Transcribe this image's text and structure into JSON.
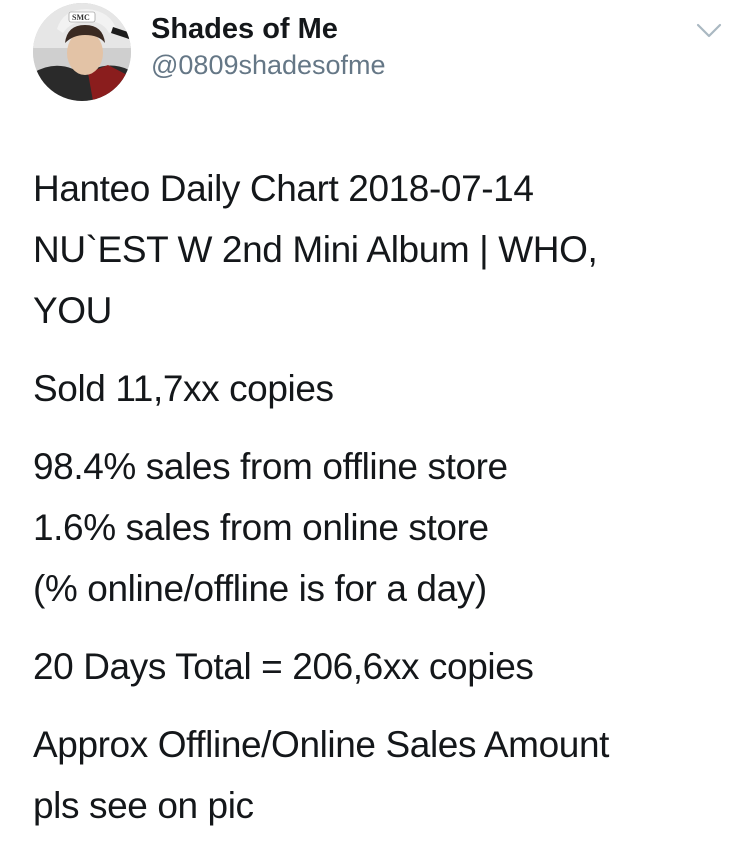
{
  "tweet": {
    "author": {
      "display_name": "Shades of Me",
      "handle": "@0809shadesofme",
      "avatar_icon": "profile-photo",
      "avatar_cap_text": "SMC"
    },
    "menu_icon": "chevron-down-icon",
    "body_lines": [
      "Hanteo Daily Chart 2018-07-14",
      "NU`EST W 2nd Mini Album | WHO,",
      "YOU",
      "Sold 11,7xx copies",
      "98.4% sales from offline store",
      "1.6% sales from online store",
      "(% online/offline is for a day)",
      "20 Days Total = 206,6xx copies",
      "Approx Offline/Online Sales Amount",
      "pls see on pic"
    ],
    "colors": {
      "text": "#14171a",
      "secondary_text": "#657786",
      "chevron": "#aab8c2"
    }
  }
}
